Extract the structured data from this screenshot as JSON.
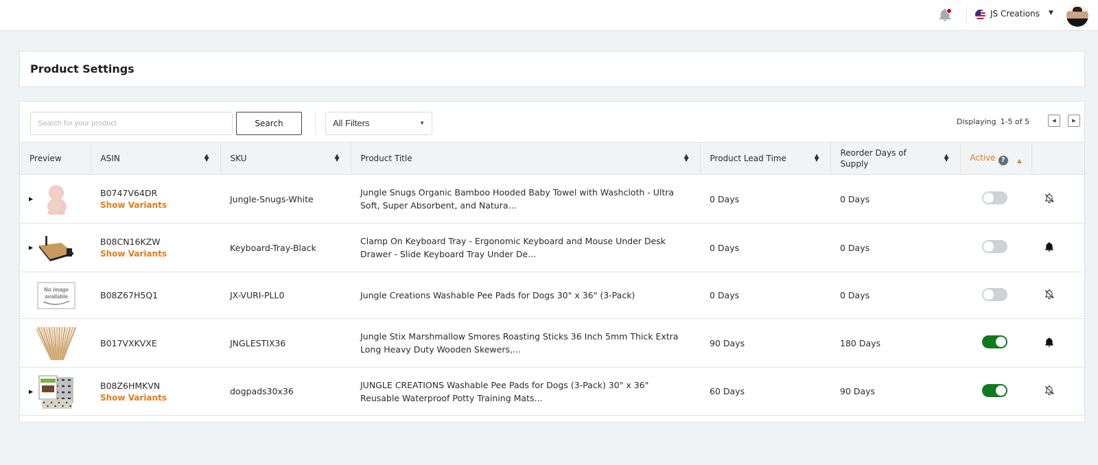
{
  "topbar": {
    "notification_icon": "bell-icon",
    "account_flag": "us-flag-icon",
    "account_name": "JS Creations",
    "account_caret": "▼",
    "avatar": "user-avatar"
  },
  "page": {
    "title": "Product Settings"
  },
  "toolbar": {
    "search_placeholder": "Search for your product",
    "search_value": "",
    "search_button": "Search",
    "filter_selected": "All Filters",
    "filter_caret": "▾",
    "displaying_label": "Displaying",
    "displaying_range": "1-5 of 5",
    "prev_icon": "◀",
    "next_icon": "▶"
  },
  "table": {
    "columns": [
      {
        "label": "Preview",
        "sortable": false
      },
      {
        "label": "ASIN",
        "sortable": true
      },
      {
        "label": "SKU",
        "sortable": true
      },
      {
        "label": "Product Title",
        "sortable": true
      },
      {
        "label": "Product Lead Time",
        "sortable": true
      },
      {
        "label": "Reorder Days of Supply",
        "sortable": true
      },
      {
        "label": "Active",
        "sortable": true,
        "sorted": "ascending",
        "help": "?"
      },
      {
        "label": "",
        "sortable": false
      }
    ],
    "sort_glyph_up": "▲",
    "sort_glyph_down": "▼",
    "rows": [
      {
        "expandable": true,
        "expand_icon": "▶",
        "preview": "baby-towel-image",
        "asin": "B0747V64DR",
        "show_variants": "Show Variants",
        "sku": "Jungle-Snugs-White",
        "title": "Jungle Snugs Organic Bamboo Hooded Baby Towel with Washcloth - Ultra Soft, Super Absorbent, and Natura...",
        "lead_time": "0 Days",
        "reorder_days": "0 Days",
        "active": false,
        "alerts": "muted"
      },
      {
        "expandable": true,
        "expand_icon": "▶",
        "preview": "keyboard-tray-image",
        "asin": "B08CN16KZW",
        "show_variants": "Show Variants",
        "sku": "Keyboard-Tray-Black",
        "title": "Clamp On Keyboard Tray - Ergonomic Keyboard and Mouse Under Desk Drawer - Slide Keyboard Tray Under De...",
        "lead_time": "0 Days",
        "reorder_days": "0 Days",
        "active": false,
        "alerts": "on"
      },
      {
        "expandable": false,
        "expand_icon": "",
        "preview": "no-image-available",
        "preview_text": "No image available",
        "asin": "B08Z67H5Q1",
        "show_variants": "",
        "sku": "JX-VURI-PLL0",
        "title": "Jungle Creations Washable Pee Pads for Dogs 30\" x 36\" (3-Pack)",
        "lead_time": "0 Days",
        "reorder_days": "0 Days",
        "active": false,
        "alerts": "muted"
      },
      {
        "expandable": false,
        "expand_icon": "",
        "preview": "roasting-sticks-image",
        "asin": "B017VXKVXE",
        "show_variants": "",
        "sku": "JNGLESTIX36",
        "title": "Jungle Stix Marshmallow Smores Roasting Sticks 36 Inch 5mm Thick Extra Long Heavy Duty Wooden Skewers,...",
        "lead_time": "90 Days",
        "reorder_days": "180 Days",
        "active": true,
        "alerts": "on"
      },
      {
        "expandable": true,
        "expand_icon": "▶",
        "preview": "dog-pads-image",
        "asin": "B08Z6HMKVN",
        "show_variants": "Show Variants",
        "sku": "dogpads30x36",
        "title": "JUNGLE CREATIONS Washable Pee Pads for Dogs (3-Pack) 30\" x 36\" Reusable Waterproof Potty Training Mats...",
        "lead_time": "60 Days",
        "reorder_days": "90 Days",
        "active": true,
        "alerts": "muted"
      }
    ]
  },
  "colors": {
    "accent_orange": "#e07b1a",
    "toggle_on": "#0f7b1c",
    "toggle_off": "#cdd3d6",
    "notification_dot": "#d0021b",
    "page_bg": "#f0f3f6"
  }
}
